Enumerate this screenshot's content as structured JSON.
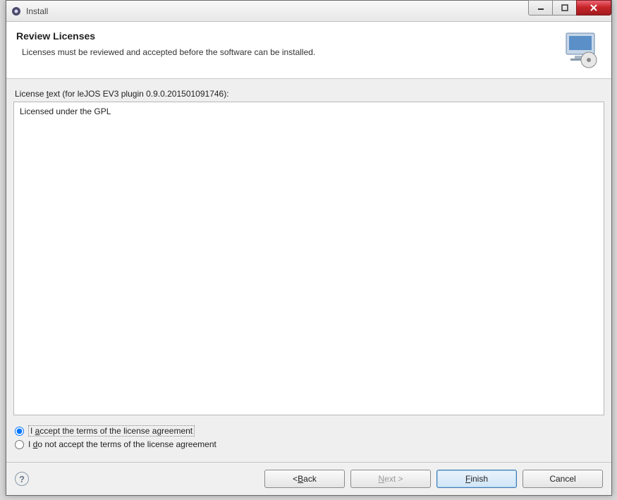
{
  "window": {
    "title": "Install"
  },
  "header": {
    "title": "Review Licenses",
    "subtitle": "Licenses must be reviewed and accepted before the software can be installed."
  },
  "license": {
    "label_prefix": "License ",
    "label_underlined": "t",
    "label_suffix": "ext (for leJOS EV3 plugin 0.9.0.201501091746):",
    "text": "Licensed under the GPL"
  },
  "radio": {
    "accept_prefix": "I ",
    "accept_u": "a",
    "accept_suffix": "ccept the terms of the license agreement",
    "decline_prefix": "I ",
    "decline_u": "d",
    "decline_suffix": "o not accept the terms of the license agreement",
    "selected": "accept"
  },
  "buttons": {
    "back_prefix": "< ",
    "back_u": "B",
    "back_suffix": "ack",
    "next_u": "N",
    "next_suffix": "ext >",
    "finish_u": "F",
    "finish_suffix": "inish",
    "cancel": "Cancel"
  }
}
